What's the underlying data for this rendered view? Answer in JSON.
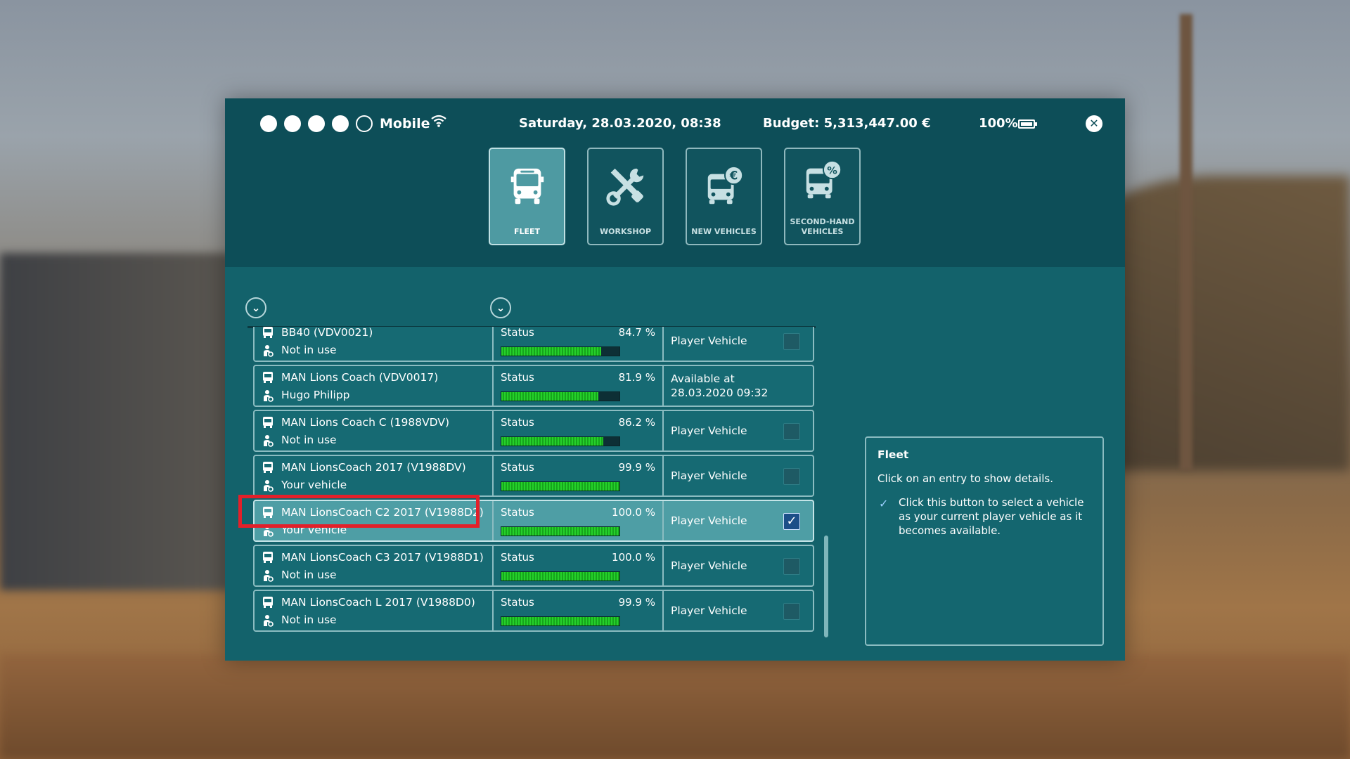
{
  "status_bar": {
    "carrier": "Mobile",
    "signal_bars_filled": 4,
    "signal_bars_total": 5,
    "datetime": "Saturday, 28.03.2020, 08:38",
    "budget": "Budget: 5,313,447.00 €",
    "battery": "100%"
  },
  "nav": {
    "tiles": [
      {
        "label": "FLEET",
        "active": true,
        "icon": "bus-front-icon"
      },
      {
        "label": "WORKSHOP",
        "active": false,
        "icon": "tools-icon"
      },
      {
        "label": "NEW VEHICLES",
        "active": false,
        "icon": "bus-euro-icon"
      },
      {
        "label": "SECOND-HAND VEHICLES",
        "active": false,
        "icon": "bus-percent-icon"
      }
    ]
  },
  "fleet": {
    "status_label": "Status",
    "rows": [
      {
        "name": "BB40 (VDV0021)",
        "driver": "Not in use",
        "status_pct": "84.7 %",
        "status_value": 0.847,
        "player_vehicle": "Player Vehicle",
        "checked": false
      },
      {
        "name": "MAN Lions Coach (VDV0017)",
        "driver": "Hugo Philipp",
        "status_pct": "81.9 %",
        "status_value": 0.819,
        "player_vehicle": "Available at\n28.03.2020  09:32",
        "checked": null
      },
      {
        "name": "MAN Lions Coach C (1988VDV)",
        "driver": "Not in use",
        "status_pct": "86.2 %",
        "status_value": 0.862,
        "player_vehicle": "Player Vehicle",
        "checked": false
      },
      {
        "name": "MAN LionsCoach 2017 (V1988DV)",
        "driver": "Your vehicle",
        "status_pct": "99.9 %",
        "status_value": 0.999,
        "player_vehicle": "Player Vehicle",
        "checked": false
      },
      {
        "name": "MAN LionsCoach C2 2017 (V1988D2)",
        "driver": "Your vehicle",
        "status_pct": "100.0 %",
        "status_value": 1.0,
        "player_vehicle": "Player Vehicle",
        "checked": true,
        "selected": true
      },
      {
        "name": "MAN LionsCoach C3 2017 (V1988D1)",
        "driver": "Not in use",
        "status_pct": "100.0 %",
        "status_value": 1.0,
        "player_vehicle": "Player Vehicle",
        "checked": false
      },
      {
        "name": "MAN LionsCoach L 2017 (V1988D0)",
        "driver": "Not in use",
        "status_pct": "99.9 %",
        "status_value": 0.999,
        "player_vehicle": "Player Vehicle",
        "checked": false
      }
    ]
  },
  "info": {
    "title": "Fleet",
    "description": "Click on an entry to show details.",
    "hint": "Click this button to select a vehicle as your current player vehicle as it becomes available."
  },
  "colors": {
    "panel": "#13626b",
    "header": "#0d4e58",
    "selected_row": "#4e9ea5",
    "status_bar_fill": "#25d02b",
    "highlight": "#e2202a"
  }
}
